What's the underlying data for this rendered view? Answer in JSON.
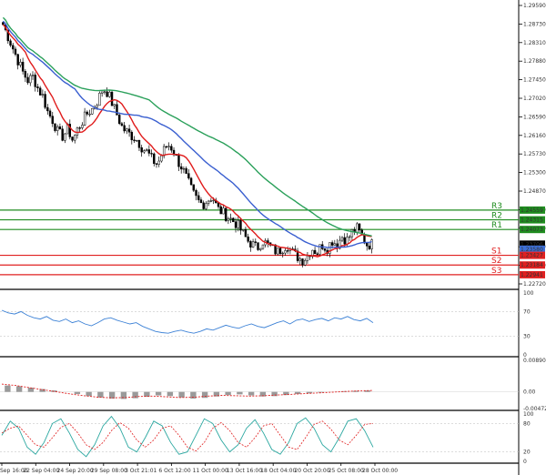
{
  "chart_data": {
    "type": "candlestick",
    "price_axis": {
      "ticks": [
        "1.29590",
        "1.28730",
        "1.28310",
        "1.27880",
        "1.27450",
        "1.27020",
        "1.26590",
        "1.26160",
        "1.25730",
        "1.25300",
        "1.24870",
        "1.24440",
        "1.24010",
        "1.23580",
        "1.23150",
        "1.22720"
      ],
      "ylim": [
        1.2262,
        1.2968
      ]
    },
    "time_axis": {
      "ticks": [
        "Sep 16:00",
        "22 Sep 04:00",
        "24 Sep 20:00",
        "29 Sep 08:00",
        "3 Oct 21:01",
        "6 Oct 12:00",
        "11 Oct 00:00",
        "13 Oct 16:00",
        "18 Oct 04:00",
        "20 Oct 20:00",
        "25 Oct 08:00",
        "28 Oct 00:00"
      ]
    },
    "levels": [
      {
        "name": "R3",
        "value": 1.24559,
        "color": "#1f8c1f"
      },
      {
        "name": "R2",
        "value": 1.24315,
        "color": "#1f8c1f"
      },
      {
        "name": "R1",
        "value": 1.24073,
        "color": "#1f8c1f"
      },
      {
        "name": "S1",
        "value": 1.23427,
        "color": "#e02020"
      },
      {
        "name": "S2",
        "value": 1.23184,
        "color": "#e02020"
      },
      {
        "name": "S3",
        "value": 1.22941,
        "color": "#e02020"
      }
    ],
    "price_tags": [
      {
        "value": 1.24559,
        "text": "1.24559",
        "color": "#1f8c1f"
      },
      {
        "value": 1.24315,
        "text": "1.24315",
        "color": "#1f8c1f"
      },
      {
        "value": 1.24073,
        "text": "1.24073",
        "color": "#1f8c1f"
      },
      {
        "value": 1.23706,
        "text": "1.23706",
        "color": "#000000"
      },
      {
        "value": 1.2358,
        "text": "1.23580",
        "color": "#3d6fd6"
      },
      {
        "value": 1.23427,
        "text": "1.23427",
        "color": "#e02020"
      },
      {
        "value": 1.23184,
        "text": "1.23184",
        "color": "#e02020"
      },
      {
        "value": 1.22941,
        "text": "1.22941",
        "color": "#e02020"
      }
    ],
    "close_path": [
      1.292,
      1.289,
      1.286,
      1.283,
      1.28,
      1.278,
      1.279,
      1.276,
      1.274,
      1.27,
      1.268,
      1.265,
      1.264,
      1.266,
      1.263,
      1.266,
      1.268,
      1.27,
      1.271,
      1.273,
      1.276,
      1.275,
      1.272,
      1.269,
      1.266,
      1.265,
      1.264,
      1.263,
      1.261,
      1.26,
      1.258,
      1.257,
      1.26,
      1.262,
      1.261,
      1.258,
      1.256,
      1.253,
      1.25,
      1.248,
      1.247,
      1.248,
      1.249,
      1.246,
      1.245,
      1.244,
      1.243,
      1.242,
      1.24,
      1.238,
      1.237,
      1.236,
      1.238,
      1.237,
      1.236,
      1.235,
      1.236,
      1.237,
      1.235,
      1.234,
      1.233,
      1.234,
      1.236,
      1.235,
      1.237,
      1.236,
      1.238,
      1.237,
      1.239,
      1.238,
      1.24,
      1.241,
      1.239,
      1.237,
      1.2371
    ],
    "rsi": {
      "ticks": [
        "100",
        "70",
        "30",
        "0"
      ],
      "ylim": [
        0,
        100
      ],
      "values": [
        72,
        68,
        66,
        70,
        64,
        60,
        58,
        62,
        56,
        54,
        58,
        52,
        55,
        50,
        47,
        52,
        58,
        60,
        56,
        53,
        50,
        52,
        46,
        42,
        38,
        36,
        35,
        38,
        40,
        37,
        35,
        38,
        42,
        40,
        44,
        48,
        45,
        43,
        47,
        50,
        46,
        44,
        48,
        52,
        55,
        50,
        56,
        58,
        54,
        57,
        59,
        55,
        60,
        58,
        62,
        57,
        55,
        59,
        52
      ]
    },
    "macd": {
      "ticks": [
        "0.008907",
        "0.00",
        "-0.004722"
      ],
      "ylim": [
        -0.004722,
        0.008907
      ],
      "histogram": [
        0.0018,
        0.0016,
        0.0012,
        0.0008,
        0.0004,
        0.0,
        -0.0006,
        -0.0012,
        -0.0016,
        -0.0019,
        -0.002,
        -0.0018,
        -0.0014,
        -0.001,
        -0.0012,
        -0.0016,
        -0.0019,
        -0.0017,
        -0.0013,
        -0.0009,
        -0.0007,
        -0.001,
        -0.0013,
        -0.0012,
        -0.0009,
        -0.0006,
        -0.0004,
        -0.0002,
        0.0,
        0.0002,
        0.0003,
        0.0004
      ],
      "signal": [
        0.0022,
        0.0018,
        0.0012,
        0.0006,
        0.0,
        -0.0006,
        -0.0011,
        -0.0015,
        -0.0017,
        -0.0016,
        -0.0013,
        -0.0012,
        -0.0014,
        -0.0016,
        -0.0015,
        -0.0012,
        -0.001,
        -0.0011,
        -0.0012,
        -0.0011,
        -0.0009,
        -0.0007,
        -0.0005,
        -0.0003,
        -0.0001,
        0.0001,
        0.0003,
        0.0004
      ]
    },
    "stochastic": {
      "ticks": [
        "100",
        "80",
        "20",
        "0"
      ],
      "ylim": [
        0,
        100
      ],
      "k": [
        55,
        85,
        70,
        30,
        15,
        40,
        80,
        90,
        60,
        25,
        10,
        35,
        75,
        95,
        70,
        30,
        20,
        50,
        85,
        75,
        40,
        15,
        20,
        55,
        90,
        80,
        45,
        20,
        35,
        70,
        88,
        60,
        25,
        15,
        40,
        80,
        92,
        70,
        35,
        20,
        50,
        85,
        90,
        65,
        30
      ],
      "d": [
        60,
        70,
        75,
        55,
        35,
        30,
        50,
        72,
        80,
        60,
        35,
        25,
        40,
        65,
        82,
        70,
        45,
        30,
        45,
        70,
        75,
        55,
        30,
        22,
        40,
        70,
        82,
        65,
        40,
        30,
        50,
        75,
        80,
        55,
        30,
        25,
        50,
        78,
        85,
        68,
        45,
        35,
        55,
        78,
        80
      ]
    }
  }
}
